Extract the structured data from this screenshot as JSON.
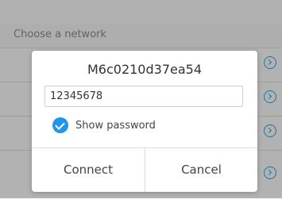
{
  "background": {
    "section_label": "Choose a network",
    "rows": [
      {
        "name": ""
      },
      {
        "name": ""
      },
      {
        "name": ""
      },
      {
        "name": ""
      }
    ]
  },
  "dialog": {
    "title": "M6c0210d37ea54",
    "password_value": "12345678",
    "show_password_label": "Show password",
    "show_password_checked": true,
    "connect_label": "Connect",
    "cancel_label": "Cancel"
  },
  "colors": {
    "accent": "#2196e8"
  }
}
